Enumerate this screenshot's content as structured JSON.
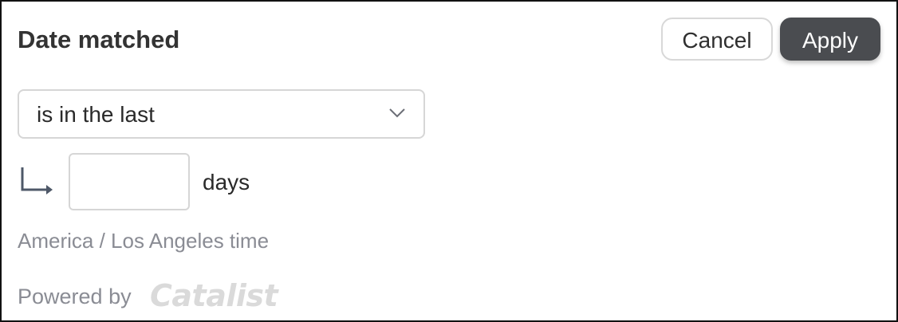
{
  "header": {
    "title": "Date matched",
    "cancel_label": "Cancel",
    "apply_label": "Apply"
  },
  "filter": {
    "operator_selected": "is in the last",
    "days_value": "",
    "days_unit_label": "days"
  },
  "timezone_label": "America / Los Angeles time",
  "footer": {
    "powered_by_label": "Powered by",
    "brand_logo_text": "Catalist"
  },
  "icons": {
    "dropdown": "chevron-down-icon",
    "indent": "return-arrow-icon"
  },
  "colors": {
    "apply_button": "#4a4c50",
    "muted_text": "#8a8c94",
    "border": "#d6d6d6"
  }
}
